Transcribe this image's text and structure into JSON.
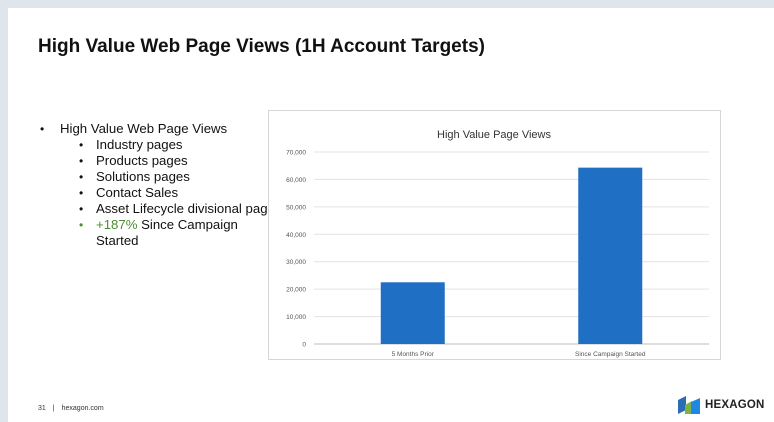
{
  "slide": {
    "title": "High Value Web Page Views (1H Account Targets)",
    "bullets": {
      "main": "High Value Web Page Views",
      "sub": [
        "Industry pages",
        "Products pages",
        "Solutions pages",
        "Contact Sales",
        "Asset Lifecycle divisional page"
      ],
      "highlight_pct": "+187%",
      "highlight_rest": " Since Campaign Started"
    },
    "footer": {
      "page": "31",
      "separator": "|",
      "site": "hexagon.com"
    },
    "logo": {
      "text": "HEXAGON",
      "colors": [
        "#2b6cb5",
        "#7cb342",
        "#1e88e5"
      ]
    }
  },
  "chart_data": {
    "type": "bar",
    "title": "High Value Page Views",
    "categories": [
      "5 Months Prior",
      "Since Campaign Started"
    ],
    "values": [
      22500,
      64300
    ],
    "ylim": [
      0,
      70000
    ],
    "yticks": [
      0,
      10000,
      20000,
      30000,
      40000,
      50000,
      60000,
      70000
    ],
    "ytick_labels": [
      "0",
      "10,000",
      "20,000",
      "30,000",
      "40,000",
      "50,000",
      "60,000",
      "70,000"
    ],
    "grid": true,
    "legend": "none",
    "bar_color": "#1f6fc5"
  }
}
